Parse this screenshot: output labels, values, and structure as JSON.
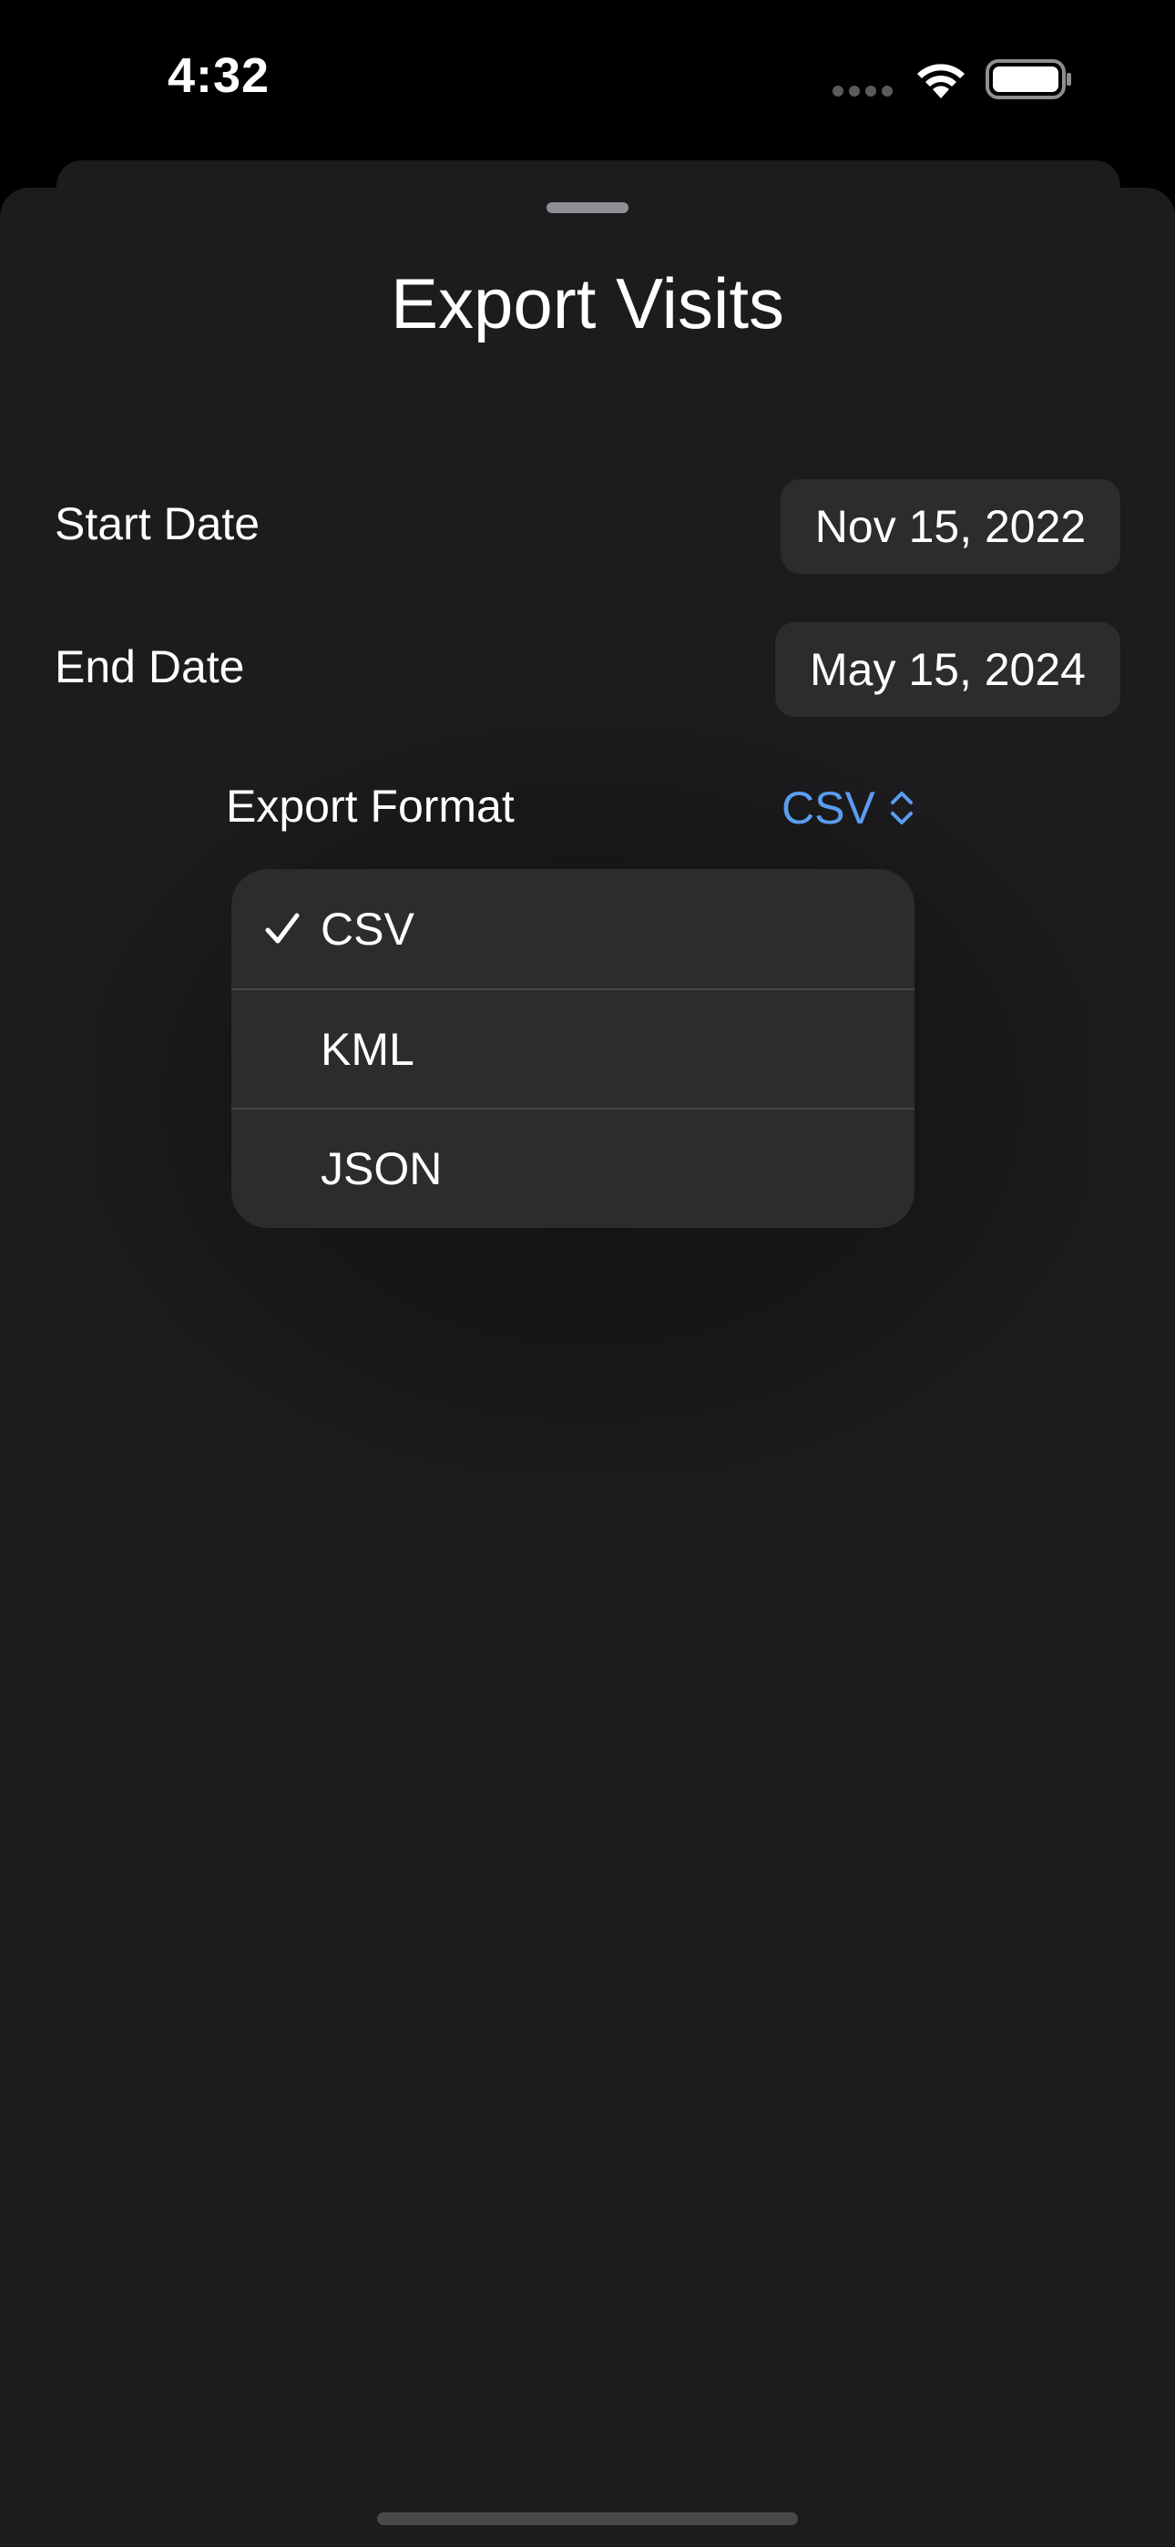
{
  "status_bar": {
    "time": "4:32"
  },
  "sheet": {
    "title": "Export Visits"
  },
  "form": {
    "start_date": {
      "label": "Start Date",
      "value": "Nov 15, 2022"
    },
    "end_date": {
      "label": "End Date",
      "value": "May 15, 2024"
    },
    "export_format": {
      "label": "Export Format",
      "selected": "CSV",
      "options": [
        "CSV",
        "KML",
        "JSON"
      ]
    }
  },
  "colors": {
    "accent": "#5b9cf0",
    "sheet_background": "#1c1c1e",
    "control_background": "#2c2c2e"
  },
  "icons": {
    "wifi": "wifi-icon",
    "battery": "battery-icon",
    "updown": "chevron-up-down-icon",
    "check": "checkmark-icon"
  }
}
